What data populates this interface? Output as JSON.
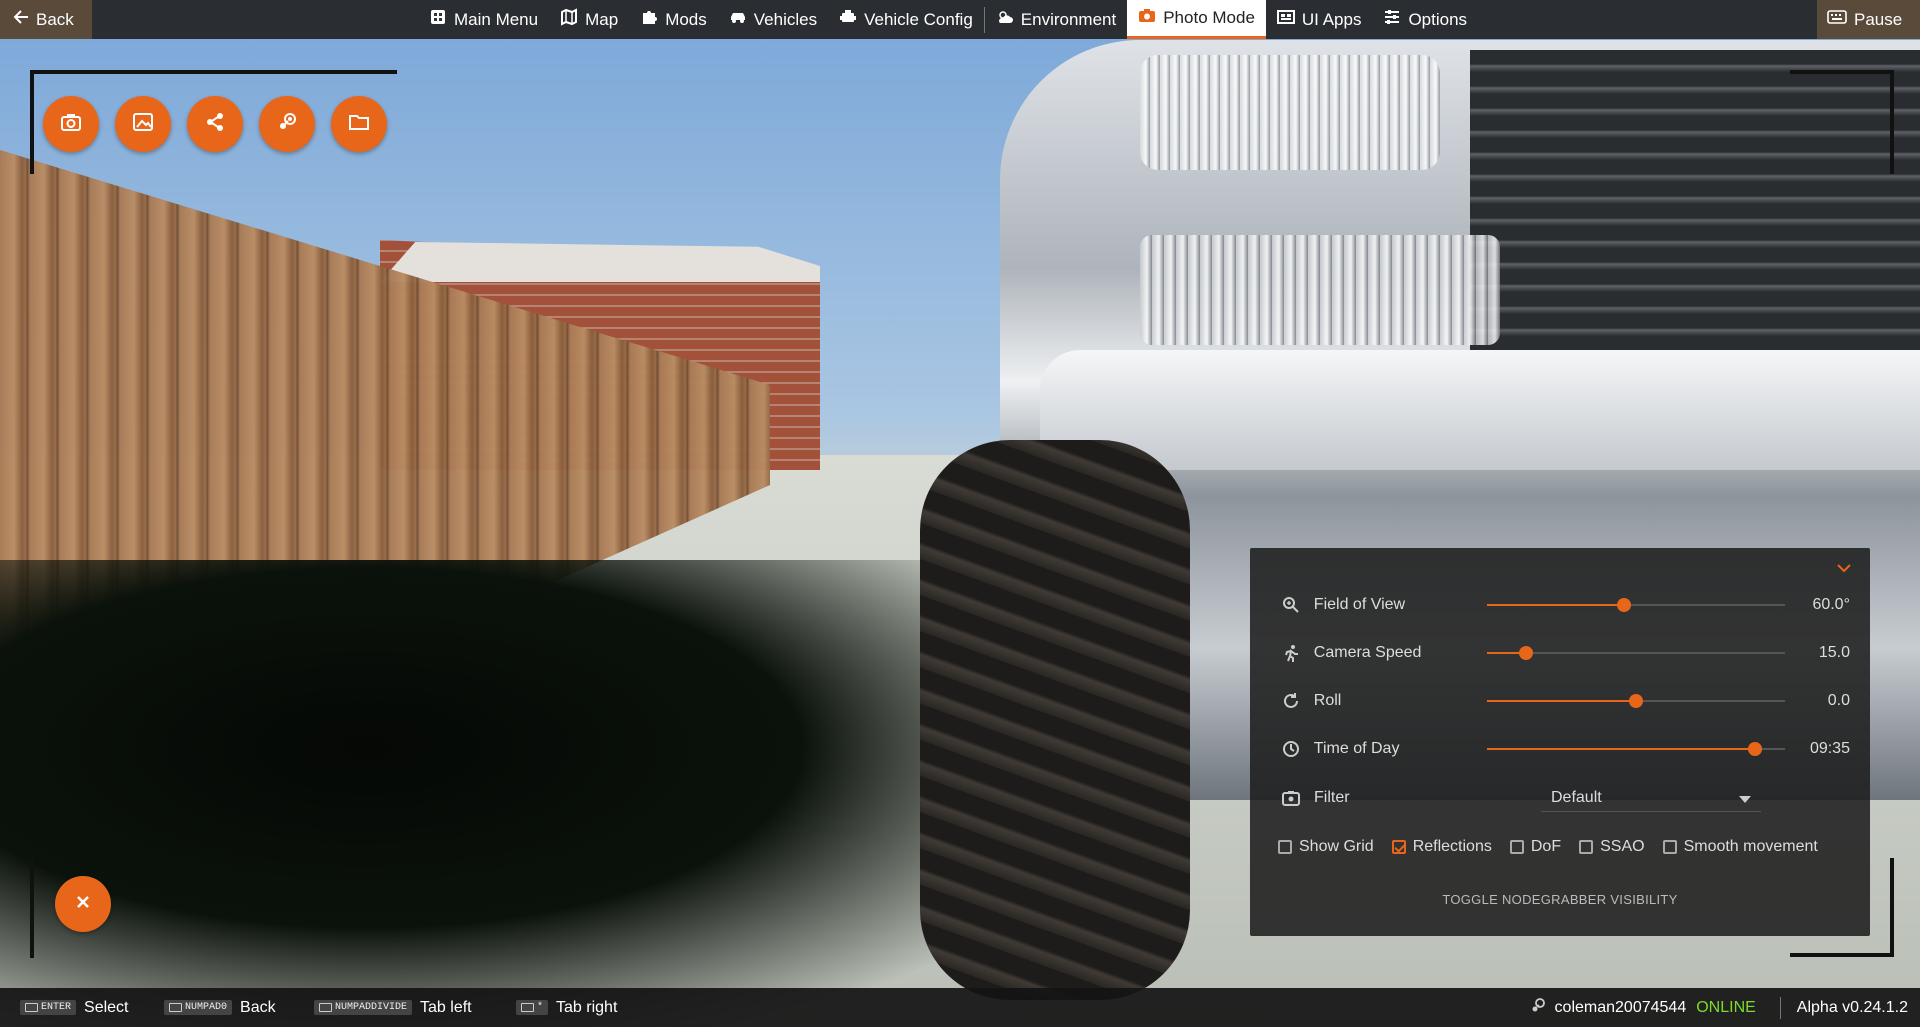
{
  "topbar": {
    "back_label": "Back",
    "pause_label": "Pause",
    "tabs": [
      {
        "label": "Main Menu",
        "icon": "main-menu-icon"
      },
      {
        "label": "Map",
        "icon": "map-icon"
      },
      {
        "label": "Mods",
        "icon": "puzzle-icon"
      },
      {
        "label": "Vehicles",
        "icon": "car-icon"
      },
      {
        "label": "Vehicle Config",
        "icon": "engine-icon"
      },
      {
        "label": "Environment",
        "icon": "weather-icon"
      },
      {
        "label": "Photo Mode",
        "icon": "camera-icon",
        "active": true
      },
      {
        "label": "UI Apps",
        "icon": "apps-icon"
      },
      {
        "label": "Options",
        "icon": "sliders-icon"
      }
    ]
  },
  "action_buttons": [
    "camera-icon",
    "image-icon",
    "share-icon",
    "steam-icon",
    "folder-icon"
  ],
  "close_button_icon": "close-icon",
  "panel": {
    "fov": {
      "label": "Field of View",
      "value": "60.0°",
      "fraction": 0.46
    },
    "speed": {
      "label": "Camera Speed",
      "value": "15.0",
      "fraction": 0.13
    },
    "roll": {
      "label": "Roll",
      "value": "0.0",
      "fraction": 0.5
    },
    "tod": {
      "label": "Time of Day",
      "value": "09:35",
      "fraction": 0.9
    },
    "filter": {
      "label": "Filter",
      "value": "Default"
    },
    "checks": {
      "grid": {
        "label": "Show Grid",
        "checked": false
      },
      "reflections": {
        "label": "Reflections",
        "checked": true
      },
      "dof": {
        "label": "DoF",
        "checked": false
      },
      "ssao": {
        "label": "SSAO",
        "checked": false
      },
      "smooth": {
        "label": "Smooth movement",
        "checked": false
      }
    },
    "toggle_label": "TOGGLE NODEGRABBER VISIBILITY"
  },
  "bottombar": {
    "hints": [
      {
        "key": "ENTER",
        "action": "Select"
      },
      {
        "key": "NUMPAD0",
        "action": "Back"
      },
      {
        "key": "NUMPADDIVIDE",
        "action": "Tab left"
      },
      {
        "key": "*",
        "action": "Tab right"
      }
    ],
    "username": "coleman20074544",
    "online": "ONLINE",
    "version": "Alpha v0.24.1.2"
  },
  "colors": {
    "accent": "#e8661a",
    "online": "#7cdc28"
  }
}
